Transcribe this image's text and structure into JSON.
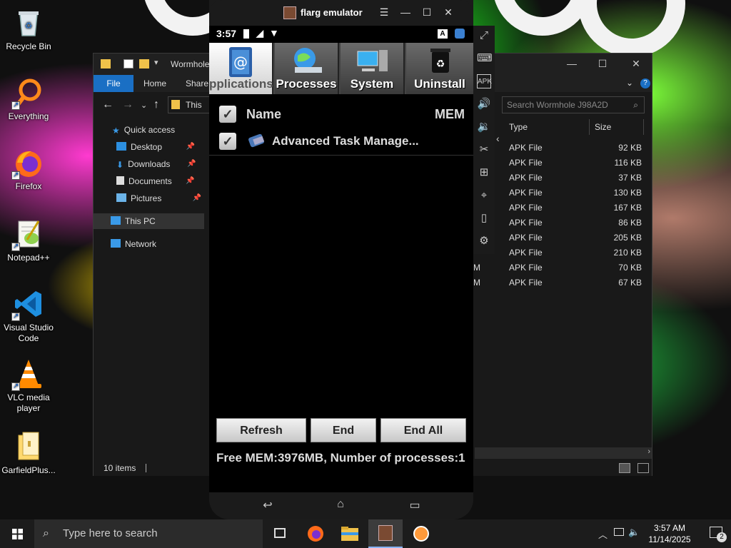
{
  "desktop": {
    "icons": [
      {
        "label": "Recycle Bin"
      },
      {
        "label": "Everything"
      },
      {
        "label": "Firefox"
      },
      {
        "label": "Notepad++"
      },
      {
        "label": "Visual Studio Code"
      },
      {
        "label": "VLC media player"
      },
      {
        "label": "GarfieldPlus..."
      }
    ]
  },
  "explorer": {
    "title": "Wormhole",
    "ribbon": {
      "file": "File",
      "home": "Home",
      "share": "Share"
    },
    "address": "This",
    "search_placeholder": "Search Wormhole J98A2D",
    "nav": {
      "quick_access": "Quick access",
      "desktop": "Desktop",
      "downloads": "Downloads",
      "documents": "Documents",
      "pictures": "Pictures",
      "this_pc": "This PC",
      "network": "Network"
    },
    "columns": {
      "type": "Type",
      "size": "Size"
    },
    "files": [
      {
        "m": "",
        "type": "APK File",
        "size": "92 KB"
      },
      {
        "m": "",
        "type": "APK File",
        "size": "116 KB"
      },
      {
        "m": "",
        "type": "APK File",
        "size": "37 KB"
      },
      {
        "m": "",
        "type": "APK File",
        "size": "130 KB"
      },
      {
        "m": "",
        "type": "APK File",
        "size": "167 KB"
      },
      {
        "m": "",
        "type": "APK File",
        "size": "86 KB"
      },
      {
        "m": "",
        "type": "APK File",
        "size": "205 KB"
      },
      {
        "m": "",
        "type": "APK File",
        "size": "210 KB"
      },
      {
        "m": "M",
        "type": "APK File",
        "size": "70 KB"
      },
      {
        "m": "M",
        "type": "APK File",
        "size": "67 KB"
      }
    ],
    "status": "10 items"
  },
  "emulator": {
    "title": "flarg emulator",
    "time": "3:57",
    "tabs": [
      "pplications",
      "Processes",
      "System",
      "Uninstall"
    ],
    "list_header": {
      "name": "Name",
      "mem": "MEM"
    },
    "row": {
      "name": "Advanced Task Manage..."
    },
    "buttons": {
      "refresh": "Refresh",
      "end": "End",
      "end_all": "End All"
    },
    "mem_info": "Free MEM:3976MB,  Number of processes:1"
  },
  "taskbar": {
    "search_placeholder": "Type here to search",
    "clock_time": "3:57 AM",
    "clock_date": "11/14/2025",
    "notif_count": "2"
  },
  "colors": {
    "accent": "#1a6fc4",
    "taskbar": "#1c1c1c",
    "explorer_bg": "#191919"
  }
}
